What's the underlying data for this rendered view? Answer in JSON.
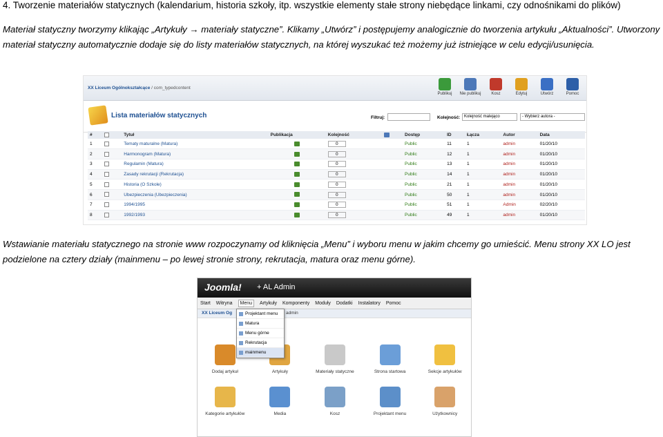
{
  "heading": "4.   Tworzenie materiałów statycznych (kalendarium, historia szkoły, itp. wszystkie elementy stałe strony niebędące linkami, czy odnośnikami do plików)",
  "paragraph1": "Materiał statyczny tworzymy klikając „Artykuły → materiały statyczne”. Klikamy „Utwórz” i postępujemy analogicznie do tworzenia artykułu „Aktualności”. Utworzony materiał statyczny automatycznie dodaje się do listy materiałów statycznych, na której wyszukać też możemy już istniejące w celu edycji/usunięcia.",
  "paragraph2": "Wstawianie materiału statycznego na stronie www rozpoczynamy od kliknięcia „Menu” i wyboru menu w jakim chcemy go umieścić. Menu strony XX LO jest podzielone na cztery działy (mainmenu – po lewej stronie strony, rekrutacja, matura oraz menu górne).",
  "screenshot1": {
    "path_site": "XX Liceum Ogólnokształcące",
    "path_rest": " / com_typedcontent",
    "toolbar": [
      {
        "label": "Publikuj",
        "icon": "publish-icon",
        "color": "#3b9a3b"
      },
      {
        "label": "Nie publikuj",
        "icon": "unpublish-icon",
        "color": "#4c78b8"
      },
      {
        "label": "Kosz",
        "icon": "trash-icon",
        "color": "#c0392b"
      },
      {
        "label": "Edytuj",
        "icon": "edit-icon",
        "color": "#e0a020"
      },
      {
        "label": "Utwórz",
        "icon": "create-icon",
        "color": "#3a6fc4"
      },
      {
        "label": "Pomoc",
        "icon": "help-icon",
        "color": "#2d5fa8"
      }
    ],
    "title": "Lista materiałów statycznych",
    "filter_label": "Filtruj:",
    "order_label": "Kolejność:",
    "order_value": "Kolejność malejąco",
    "author_value": "- Wybierz autora -",
    "columns": [
      "#",
      "",
      "Tytuł",
      "Publikacja",
      "Kolejność",
      "",
      "Dostęp",
      "ID",
      "Łącza",
      "Autor",
      "Data"
    ],
    "rows": [
      {
        "n": "1",
        "title": "Tematy maturalne (Matura)",
        "order": "0",
        "access": "Public",
        "id": "11",
        "links": "1",
        "author": "admin",
        "date": "01/20/10"
      },
      {
        "n": "2",
        "title": "Harmonogram (Matura)",
        "order": "0",
        "access": "Public",
        "id": "12",
        "links": "1",
        "author": "admin",
        "date": "01/20/10"
      },
      {
        "n": "3",
        "title": "Regulamin (Matura)",
        "order": "0",
        "access": "Public",
        "id": "13",
        "links": "1",
        "author": "admin",
        "date": "01/20/10"
      },
      {
        "n": "4",
        "title": "Zasady rekrutacji (Rekrutacja)",
        "order": "0",
        "access": "Public",
        "id": "14",
        "links": "1",
        "author": "admin",
        "date": "01/20/10"
      },
      {
        "n": "5",
        "title": "Historia (O Szkole)",
        "order": "0",
        "access": "Public",
        "id": "21",
        "links": "1",
        "author": "admin",
        "date": "01/20/10"
      },
      {
        "n": "6",
        "title": "Ubezpieczenia (Ubezpieczenia)",
        "order": "0",
        "access": "Public",
        "id": "50",
        "links": "1",
        "author": "admin",
        "date": "01/20/10"
      },
      {
        "n": "7",
        "title": "1994/1995",
        "order": "0",
        "access": "Public",
        "id": "51",
        "links": "1",
        "author": "Admin",
        "date": "02/20/10"
      },
      {
        "n": "8",
        "title": "1992/1993",
        "order": "0",
        "access": "Public",
        "id": "49",
        "links": "1",
        "author": "admin",
        "date": "01/20/10"
      }
    ]
  },
  "screenshot2": {
    "logo": "Joomla!",
    "admin_title": "+ AL Admin",
    "nav": [
      "Start",
      "Witryna",
      "Menu",
      "Artykuły",
      "Komponenty",
      "Moduły",
      "Dodatki",
      "Instalatory",
      "Pomoc"
    ],
    "site_name": "XX Liceum Og",
    "user": "admin",
    "dropdown": [
      "Projektant menu",
      "Matura",
      "Menu górne",
      "Rekrutacja",
      "mainmenu"
    ],
    "icons": [
      {
        "label": "Dodaj artykuł",
        "color": "#d98a2a"
      },
      {
        "label": "Artykuły",
        "color": "#e0a540"
      },
      {
        "label": "Materiały statyczne",
        "color": "#c9c9c9"
      },
      {
        "label": "Strona startowa",
        "color": "#6b9ed8"
      },
      {
        "label": "Sekcje artykułów",
        "color": "#f0c040"
      },
      {
        "label": "Kategorie artykułów",
        "color": "#e7b64a"
      },
      {
        "label": "Media",
        "color": "#5a90d0"
      },
      {
        "label": "Kosz",
        "color": "#7ba0c8"
      },
      {
        "label": "Projektant menu",
        "color": "#5c8fc9"
      },
      {
        "label": "Użytkownicy",
        "color": "#d9a26a"
      }
    ]
  }
}
